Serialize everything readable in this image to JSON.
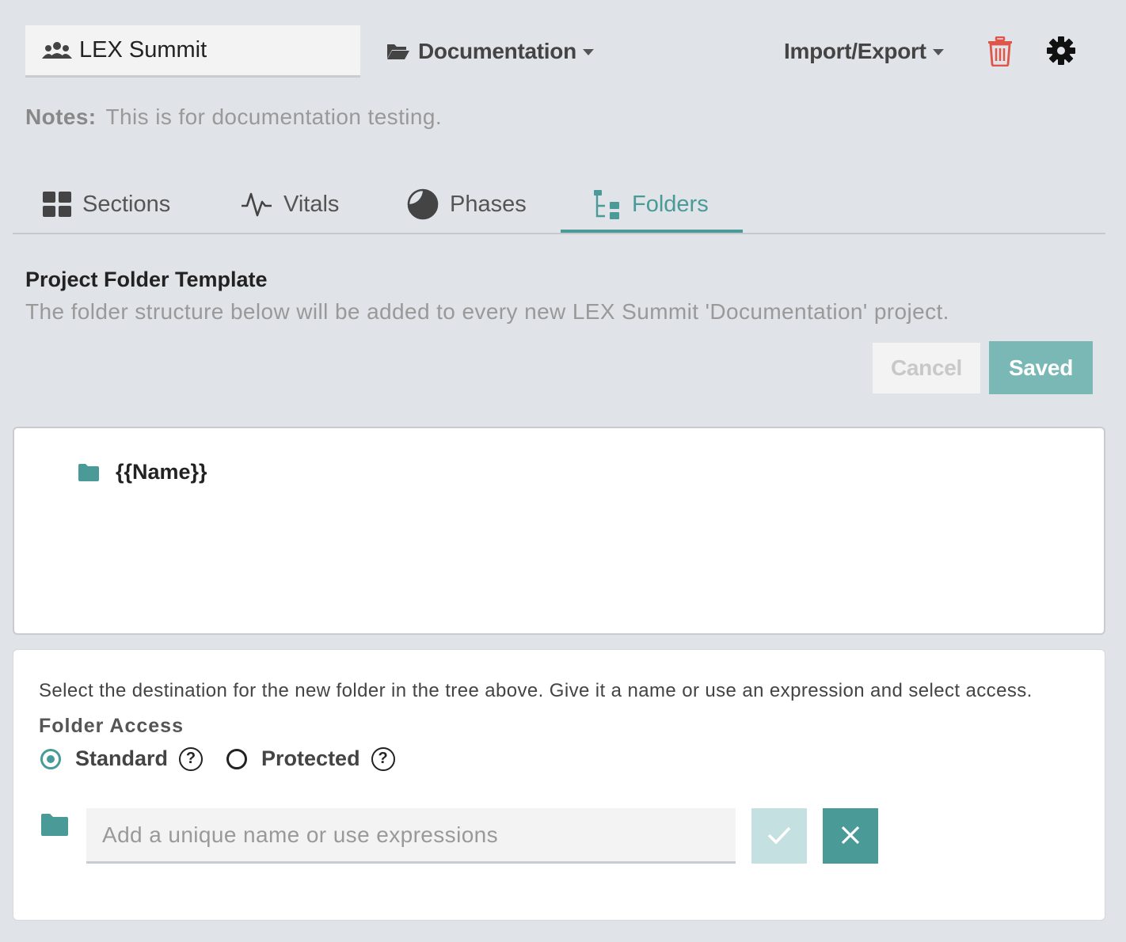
{
  "header": {
    "team_name": "LEX Summit",
    "project_type": "Documentation",
    "import_export": "Import/Export",
    "notes_label": "Notes:",
    "notes_value": "This is for documentation testing."
  },
  "tabs": [
    {
      "label": "Sections",
      "icon": "grid-icon",
      "active": false
    },
    {
      "label": "Vitals",
      "icon": "pulse-icon",
      "active": false
    },
    {
      "label": "Phases",
      "icon": "phase-moon-icon",
      "active": false
    },
    {
      "label": "Folders",
      "icon": "folder-tree-icon",
      "active": true
    }
  ],
  "template": {
    "title": "Project Folder Template",
    "description": "The folder structure below will be added to every new LEX Summit 'Documentation' project.",
    "cancel_label": "Cancel",
    "saved_label": "Saved"
  },
  "tree": {
    "items": [
      {
        "name": "{{Name}}",
        "icon": "folder-icon"
      }
    ]
  },
  "form": {
    "instructions": "Select the destination for the new folder in the tree above. Give it a name or use an expression and select access.",
    "access_label": "Folder Access",
    "options": [
      {
        "label": "Standard",
        "selected": true
      },
      {
        "label": "Protected",
        "selected": false
      }
    ],
    "help_glyph": "?",
    "name_placeholder": "Add a unique name or use expressions",
    "name_value": ""
  },
  "colors": {
    "accent": "#4a9a98",
    "danger": "#e0554a",
    "background": "#e0e3e7"
  }
}
